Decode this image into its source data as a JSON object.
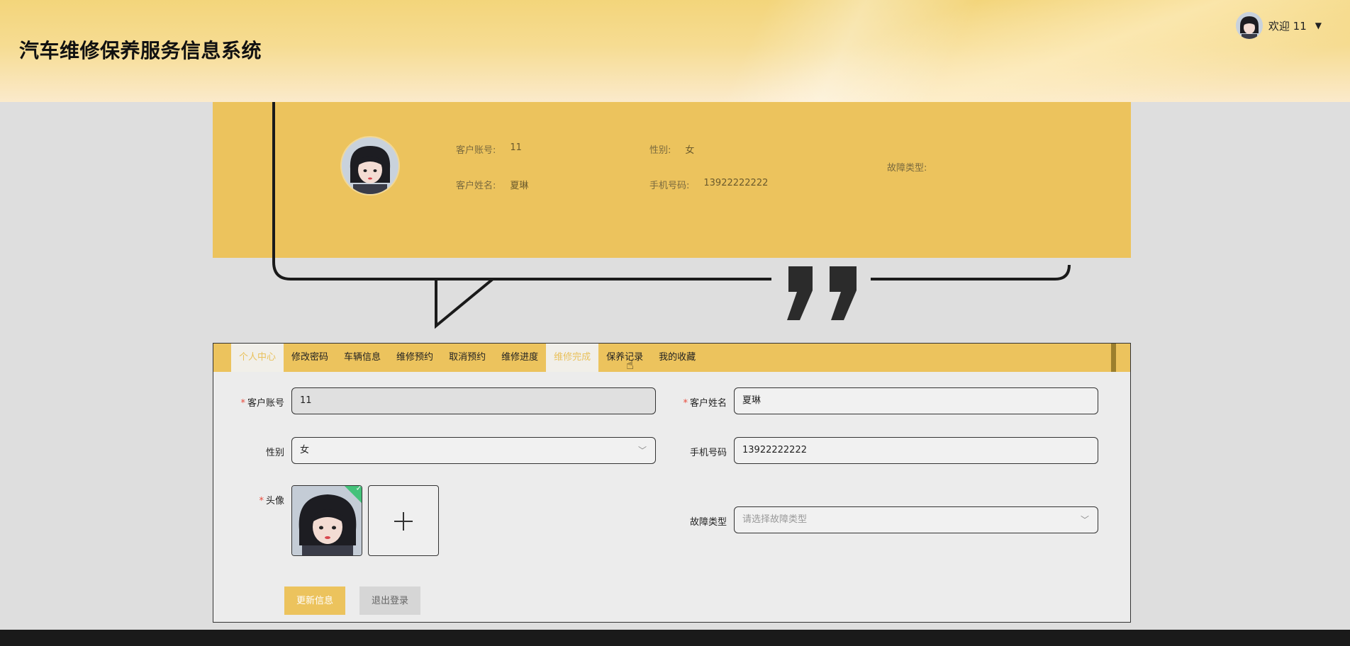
{
  "header": {
    "title": "汽车维修保养服务信息系统",
    "welcome": "欢迎 11",
    "avatar_icon": "avatar-icon",
    "caret_icon": "chevron-down-icon"
  },
  "profile": {
    "account_label": "客户账号:",
    "account_value": "11",
    "name_label": "客户姓名:",
    "name_value": "夏琳",
    "gender_label": "性别:",
    "gender_value": "女",
    "phone_label": "手机号码:",
    "phone_value": "13922222222",
    "fault_label": "故障类型:",
    "fault_value": ""
  },
  "tabs": [
    {
      "label": "个人中心",
      "state": "active"
    },
    {
      "label": "修改密码"
    },
    {
      "label": "车辆信息"
    },
    {
      "label": "维修预约"
    },
    {
      "label": "取消预约"
    },
    {
      "label": "维修进度"
    },
    {
      "label": "维修完成",
      "state": "hover"
    },
    {
      "label": "保养记录"
    },
    {
      "label": "我的收藏"
    }
  ],
  "form": {
    "account_label": "客户账号",
    "account_value": "11",
    "name_label": "客户姓名",
    "name_value": "夏琳",
    "gender_label": "性别",
    "gender_value": "女",
    "phone_label": "手机号码",
    "phone_value": "13922222222",
    "avatar_label": "头像",
    "fault_label": "故障类型",
    "fault_placeholder": "请选择故障类型",
    "update_button": "更新信息",
    "logout_button": "退出登录"
  },
  "colors": {
    "accent": "#ecc35d",
    "required": "#e84b3c",
    "success": "#44c27a"
  }
}
